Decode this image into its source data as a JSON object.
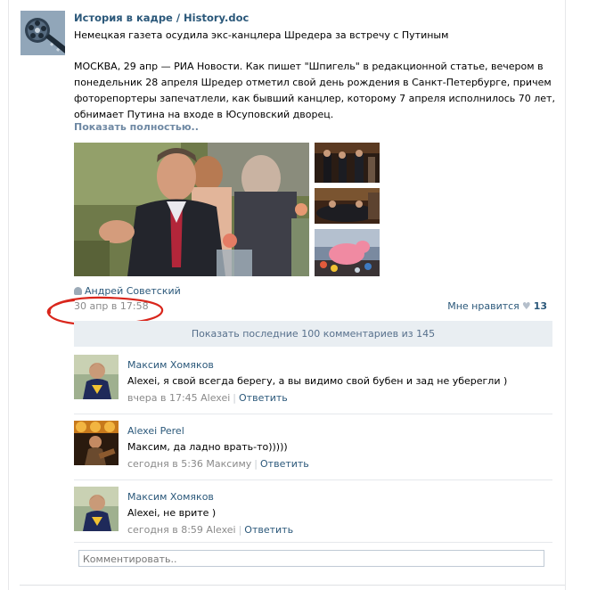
{
  "post": {
    "group_name": "История в кадре / History.doc",
    "headline": "Немецкая газета осудила экс-канцлера Шредера за встречу с Путиным",
    "body": "МОСКВА, 29 апр — РИА Новости. Как пишет \"Шпигель\" в редакционной статье, вечером в понедельник 28 апреля Шредер отметил свой день рождения в Санкт-Петербурге, причем фоторепортеры запечатлели, как бывший канцлер, которому 7 апреля исполнилось 70 лет, обнимает Путина на входе в Юсуповский дворец.",
    "show_full": "Показать полностью..",
    "author": "Андрей Советский",
    "date": "30 апр в 17:58",
    "like_label": "Мне нравится",
    "like_count": "13"
  },
  "comments_bar": {
    "show_last": "Показать последние 100 комментариев из 145"
  },
  "comments": [
    {
      "name": "Максим Хомяков",
      "text": "Alexei, я свой всегда берегу, а вы видимо свой бубен и зад не уберегли )",
      "meta": "вчера в 17:45 Alexei",
      "reply": "Ответить"
    },
    {
      "name": "Alexei Perel",
      "text": "Максим, да ладно врать-то)))))",
      "meta": "сегодня в 5:36 Максиму",
      "reply": "Ответить"
    },
    {
      "name": "Максим Хомяков",
      "text": "Alexei, не врите )",
      "meta": "сегодня в 8:59 Alexei",
      "reply": "Ответить"
    }
  ],
  "composer": {
    "placeholder": "Комментировать.."
  },
  "colors": {
    "link": "#2b587a",
    "muted": "#8a8a8a",
    "bar_bg": "#e9eef2",
    "annotation": "#d9261c"
  },
  "icons": [
    "film-reel-icon",
    "person-icon",
    "heart-icon"
  ]
}
